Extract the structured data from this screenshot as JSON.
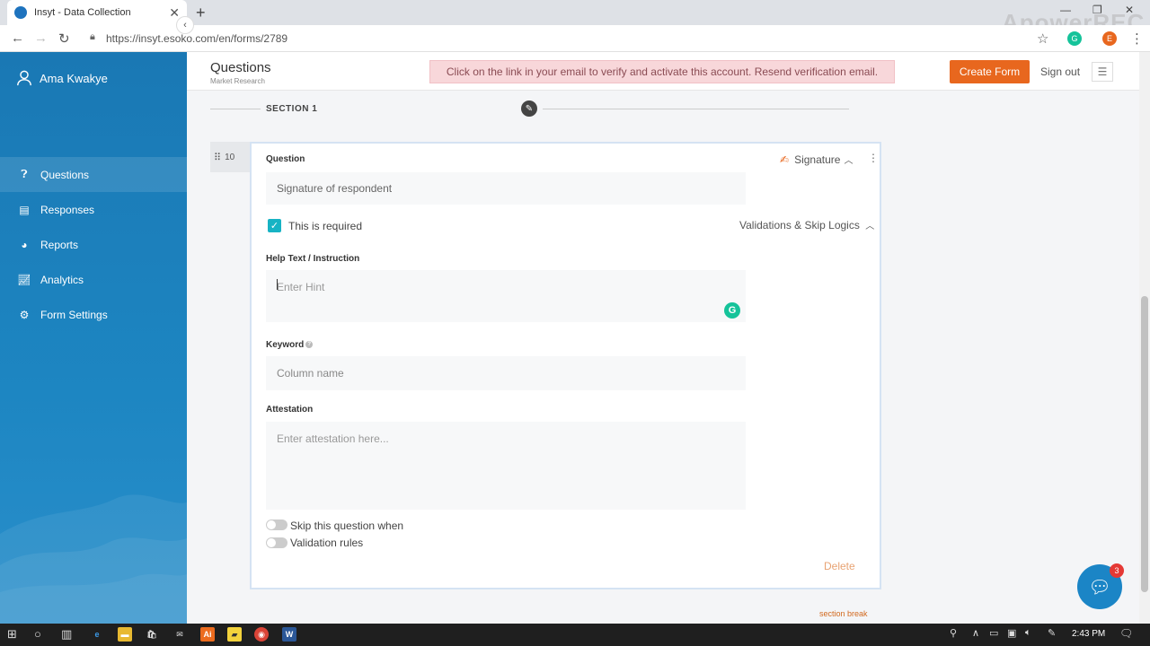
{
  "browser": {
    "tab_title": "Insyt - Data Collection",
    "url": "https://insyt.esoko.com/en/forms/2789",
    "watermark": "ApowerREC",
    "ext_avatar": "E"
  },
  "sidebar": {
    "user_name": "Ama Kwakye",
    "items": [
      {
        "label": "Questions",
        "icon": "question-circle-icon"
      },
      {
        "label": "Responses",
        "icon": "chat-icon"
      },
      {
        "label": "Reports",
        "icon": "pie-chart-icon"
      },
      {
        "label": "Analytics",
        "icon": "line-chart-icon"
      },
      {
        "label": "Form Settings",
        "icon": "gear-icon"
      }
    ]
  },
  "header": {
    "title": "Questions",
    "subtitle": "Market Research",
    "verify_text": "Click on the link in your email to verify and activate this account.",
    "verify_link": "Resend verification email.",
    "create_form": "Create Form",
    "sign_out": "Sign out"
  },
  "section": {
    "label": "SECTION 1",
    "section_break": "section break"
  },
  "question": {
    "number": "10",
    "question_label": "Question",
    "question_value": "Signature of respondent",
    "type": "Signature",
    "required_label": "This is required",
    "validations_label": "Validations & Skip Logics",
    "help_label": "Help Text / Instruction",
    "help_placeholder": "Enter Hint",
    "keyword_label": "Keyword",
    "keyword_placeholder": "Column name",
    "attestation_label": "Attestation",
    "attestation_placeholder": "Enter attestation here...",
    "skip_label": "Skip this question when",
    "validation_rules_label": "Validation rules",
    "delete_label": "Delete"
  },
  "chat": {
    "badge": "3"
  },
  "taskbar": {
    "time": "2:43 PM"
  },
  "colors": {
    "sidebar": "#1a78b4",
    "accent": "#e8671e",
    "check": "#17b3c4",
    "alert_bg": "#f8d7da"
  }
}
